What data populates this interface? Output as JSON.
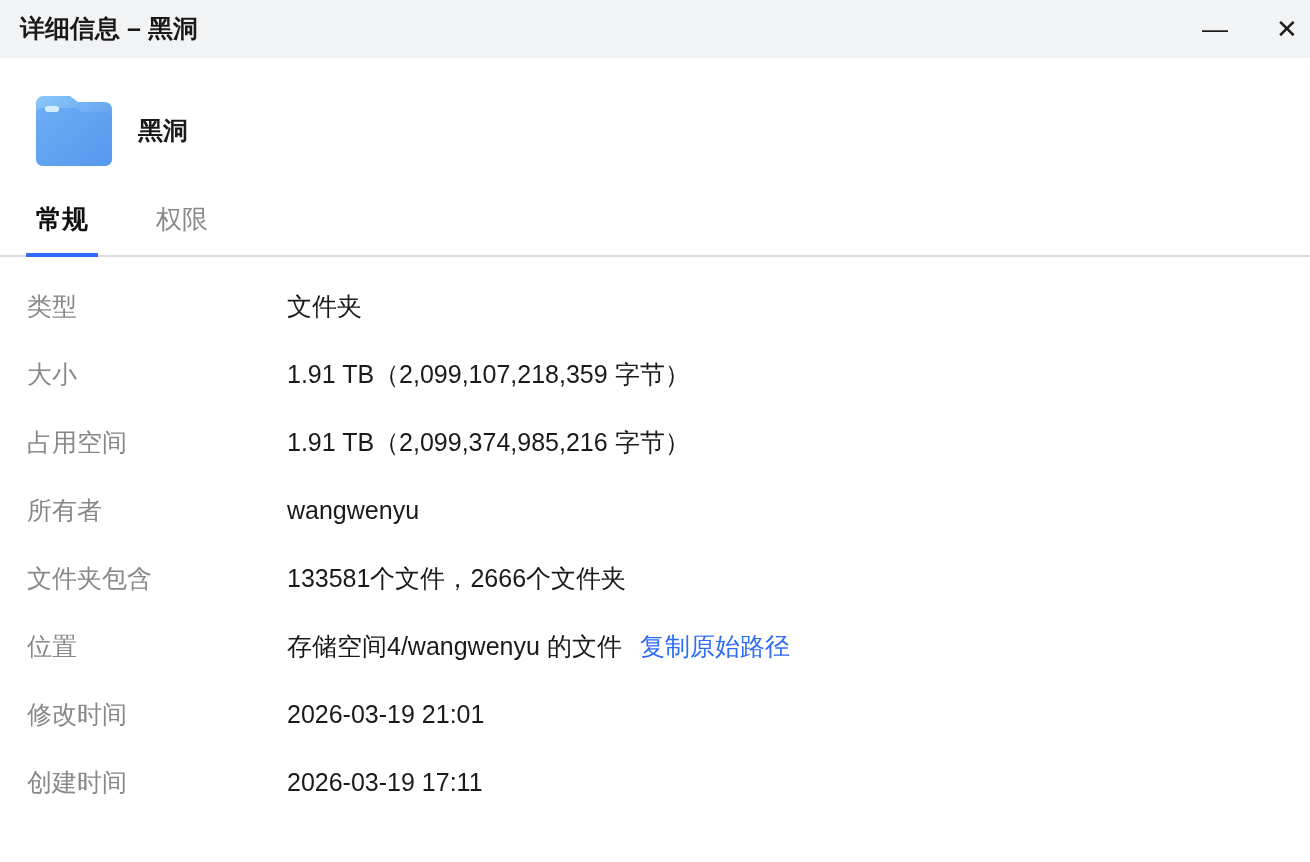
{
  "window": {
    "title": "详细信息 – 黑洞",
    "controls": [
      "—",
      "✕"
    ]
  },
  "header": {
    "name": "黑洞"
  },
  "tabs": [
    {
      "label": "常规",
      "selected": true
    },
    {
      "label": "权限",
      "selected": false
    }
  ],
  "properties": [
    {
      "label": "类型",
      "value": "文件夹"
    },
    {
      "label": "大小",
      "value": "1.91 TB（2,099,107,218,359 字节）"
    },
    {
      "label": "占用空间",
      "value": "1.91 TB（2,099,374,985,216 字节）"
    },
    {
      "label": "所有者",
      "value": "wangwenyu"
    },
    {
      "label": "文件夹包含",
      "value": "133581个文件，2666个文件夹"
    },
    {
      "label": "位置",
      "value": "存储空间4/wangwenyu 的文件",
      "link": "复制原始路径"
    },
    {
      "label": "修改时间",
      "value": "2026-03-19 21:01"
    },
    {
      "label": "创建时间",
      "value": "2026-03-19 17:11"
    }
  ]
}
